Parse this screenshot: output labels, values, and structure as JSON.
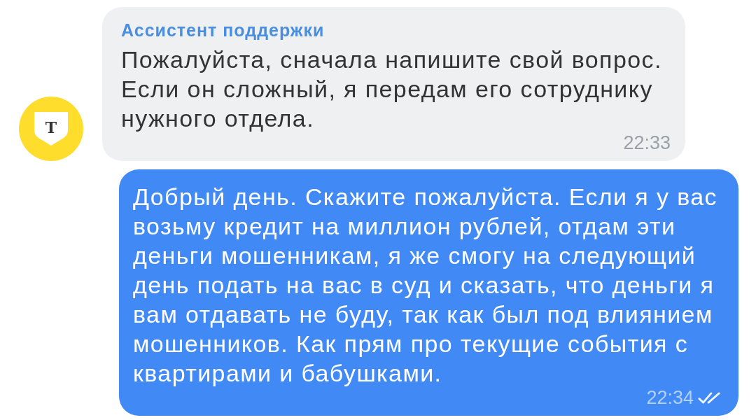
{
  "messages": [
    {
      "kind": "incoming",
      "avatar": {
        "letter": "Т"
      },
      "sender": "Ассистент поддержки",
      "text": "Пожалуйста, сначала напишите свой вопрос. Если он сложный, я передам его сотруднику нужного отдела.",
      "time": "22:33"
    },
    {
      "kind": "outgoing",
      "text": "Добрый день. Скажите пожалуйста. Если я у вас возьму кредит на миллион рублей, отдам эти деньги мошенникам, я же смогу на следующий день подать на вас в суд и сказать, что деньги я вам отдавать не буду, так как был под влиянием мошенников. Как прям про текущие события с квартирами и бабушками.",
      "time": "22:34",
      "read": true
    }
  ]
}
